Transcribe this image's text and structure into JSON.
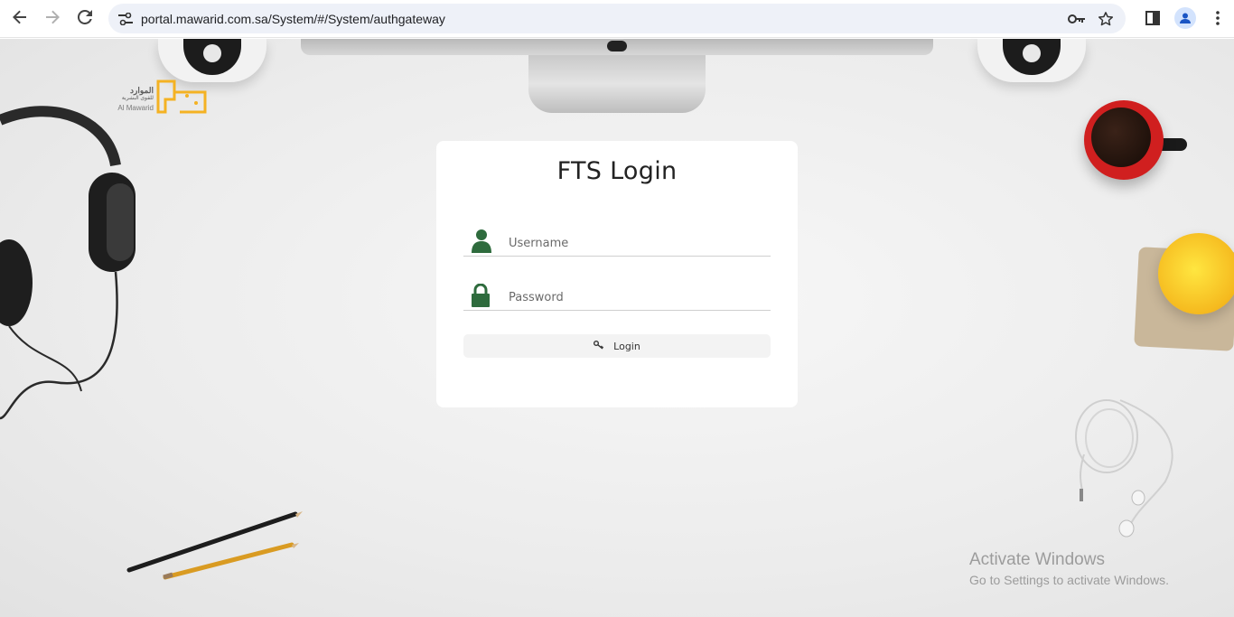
{
  "browser": {
    "url": "portal.mawarid.com.sa/System/#/System/authgateway",
    "back_icon": "arrow-left-icon",
    "forward_icon": "arrow-right-icon",
    "reload_icon": "reload-icon",
    "site_info_icon": "tune-icon",
    "password_icon": "key-icon",
    "bookmark_icon": "star-icon",
    "side_panel_icon": "side-panel-icon",
    "profile_icon": "person-icon",
    "menu_icon": "kebab-menu-icon"
  },
  "logo": {
    "arabic_name": "الموارد",
    "arabic_sub": "للقوى البشرية",
    "english_name": "Al Mawarid",
    "accent_color": "#f4b223"
  },
  "login": {
    "title": "FTS Login",
    "username_placeholder": "Username",
    "password_placeholder": "Password",
    "button_label": "Login",
    "icon_color": "#2e6b3d"
  },
  "watermark": {
    "title": "Activate Windows",
    "subtitle": "Go to Settings to activate Windows."
  }
}
